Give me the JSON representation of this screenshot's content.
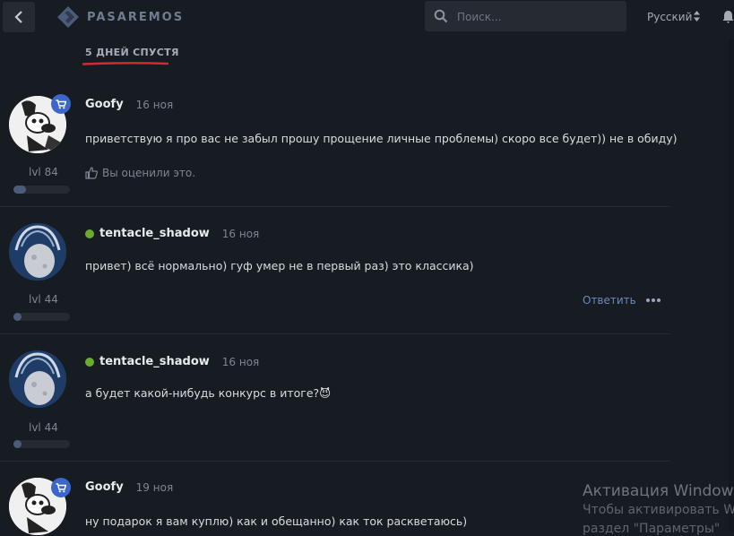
{
  "header": {
    "logo_text": "PASAREMOS",
    "search_placeholder": "Поиск...",
    "language": "Русский"
  },
  "time_gap_label": "5 ДНЕЙ СПУСТЯ",
  "posts": [
    {
      "author": "Goofy",
      "date": "16 ноя",
      "message": "приветствую я про вас не забыл прошу прощение личные проблемы) скоро все будет)) не в обиду)",
      "level": "lvl 84",
      "level_progress": 0.22,
      "like_text": "Вы оценили это."
    },
    {
      "author": "tentacle_shadow",
      "date": "16 ноя",
      "message": "привет) всё нормально) гуф умер не в первый раз) это классика)",
      "level": "lvl 44",
      "level_progress": 0.12,
      "reply_label": "Ответить"
    },
    {
      "author": "tentacle_shadow",
      "date": "16 ноя",
      "message": "а будет какой-нибудь конкурс в итоге?😈",
      "level": "lvl 44",
      "level_progress": 0.12
    },
    {
      "author": "Goofy",
      "date": "19 ноя",
      "message": "ну подарок я вам куплю) как и обещанно) как ток раскветаюсь)"
    }
  ],
  "watermark": {
    "line1": "Активация Window",
    "line2": "Чтобы активировать Win",
    "line3": "раздел \"Параметры\""
  },
  "colors": {
    "background": "#171b22",
    "accent_blue": "#3a67c9",
    "online_green": "#6aad2e",
    "underline_red": "#d42b2b"
  }
}
